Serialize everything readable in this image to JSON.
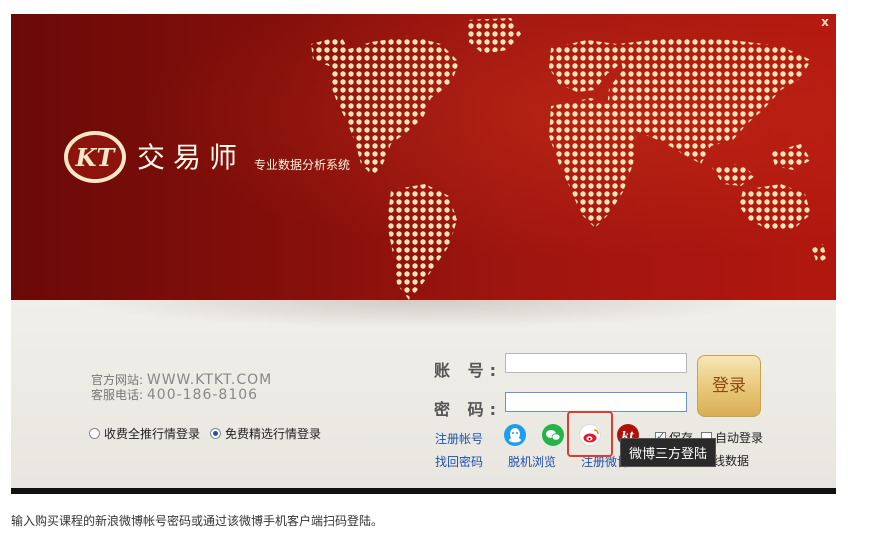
{
  "window": {
    "close_label": "x"
  },
  "brand": {
    "name": "交易师",
    "subtitle": "专业数据分析系统",
    "logo_text": "KT"
  },
  "site_info": {
    "website_label": "官方网站:",
    "website_value": "WWW.KTKT.COM",
    "phone_label": "客服电话:",
    "phone_value": "400-186-8106"
  },
  "login_mode": {
    "options": [
      {
        "label": "收费全推行情登录",
        "selected": false
      },
      {
        "label": "免费精选行情登录",
        "selected": true
      }
    ]
  },
  "form": {
    "account_label": "账 号:",
    "password_label": "密 码:",
    "account_value": "",
    "password_value": "",
    "login_button": "登录"
  },
  "links": {
    "register": "注册帐号",
    "forgot": "找回密码",
    "offline_browse": "脱机浏览",
    "weibo_register": "注册微博"
  },
  "options": {
    "save_label": "保存",
    "save_checked": true,
    "auto_login_label": "自动登录",
    "auto_login_checked": false,
    "offline_data_label": "日线数据"
  },
  "social_icons": [
    "qq-icon",
    "wechat-icon",
    "weibo-icon",
    "kt-icon"
  ],
  "tooltip": "微博三方登陆",
  "footer": "输入购买课程的新浪微博帐号密码或通过该微博手机客户端扫码登陆。",
  "colors": {
    "banner_dark": "#6a0a07",
    "banner_light": "#b1170f",
    "link": "#1d4fb0",
    "highlight": "#e23b2c",
    "button_gold": "#e9c777"
  }
}
